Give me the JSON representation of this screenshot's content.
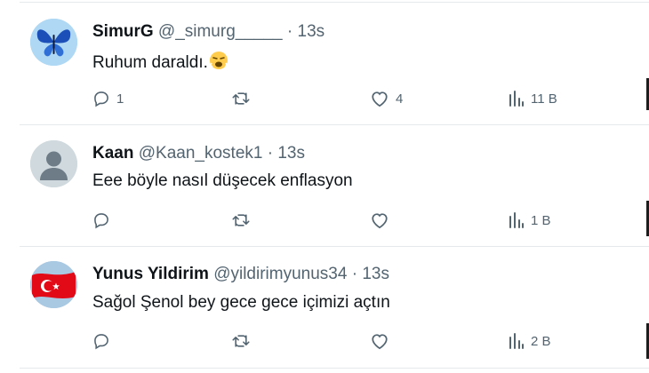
{
  "tweets": [
    {
      "name": "SimurG",
      "handle": "@_simurg_____",
      "sep": "·",
      "time": "13s",
      "text": "Ruhum daraldı.",
      "emoji": "weary-face-emoji",
      "avatar": "butterfly-avatar",
      "replies": "1",
      "retweets": "",
      "likes": "4",
      "views": "11 B"
    },
    {
      "name": "Kaan",
      "handle": "@Kaan_kostek1",
      "sep": "·",
      "time": "13s",
      "text": "Eee böyle nasıl düşecek enflasyon",
      "avatar": "default-avatar",
      "replies": "",
      "retweets": "",
      "likes": "",
      "views": "1 B"
    },
    {
      "name": "Yunus Yildirim",
      "handle": "@yildirimyunus34",
      "sep": "·",
      "time": "13s",
      "text": "Sağol Şenol bey gece gece içimizi açtın",
      "avatar": "turkish-flag-avatar",
      "replies": "",
      "retweets": "",
      "likes": "",
      "views": "2 B"
    }
  ],
  "colors": {
    "text": "#0f1419",
    "muted": "#536471",
    "divider": "#e6e9ec",
    "avatar_default_bg": "#cfd9de",
    "flag_red": "#e30a17"
  }
}
